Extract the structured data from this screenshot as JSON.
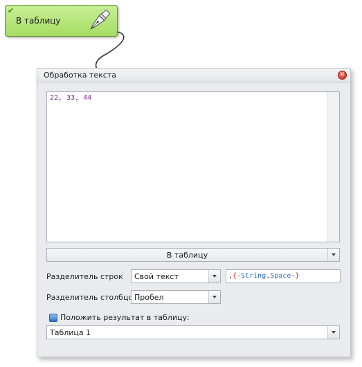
{
  "node": {
    "label": "В таблицу",
    "status_icon": "checkmark-icon",
    "action_icon": "pen-nib-icon"
  },
  "dialog": {
    "title": "Обработка текста",
    "close_icon": "close-icon",
    "text_area": {
      "content": "22, 33, 44"
    },
    "mode_select": {
      "value": "В таблицу"
    },
    "row_separator": {
      "label": "Разделитель строк",
      "select_value": "Свой текст",
      "custom_text": {
        "prefix": ",",
        "open_brace": "{",
        "dash1": "-",
        "name1": "String",
        "dot": ".",
        "name2": "Space",
        "dash2": "-",
        "close_brace": "}"
      }
    },
    "column_separator": {
      "label": "Разделитель столбцов",
      "select_value": "Пробел"
    },
    "save_result": {
      "label": "Положить результат в таблицу:",
      "checked": true
    },
    "table_select": {
      "value": "Таблица 1"
    }
  },
  "colors": {
    "node_fill": "#a6dc62",
    "text_content": "#7a2f8a",
    "close_red": "#d0241a",
    "dialog_bg": "#e9ebee"
  }
}
